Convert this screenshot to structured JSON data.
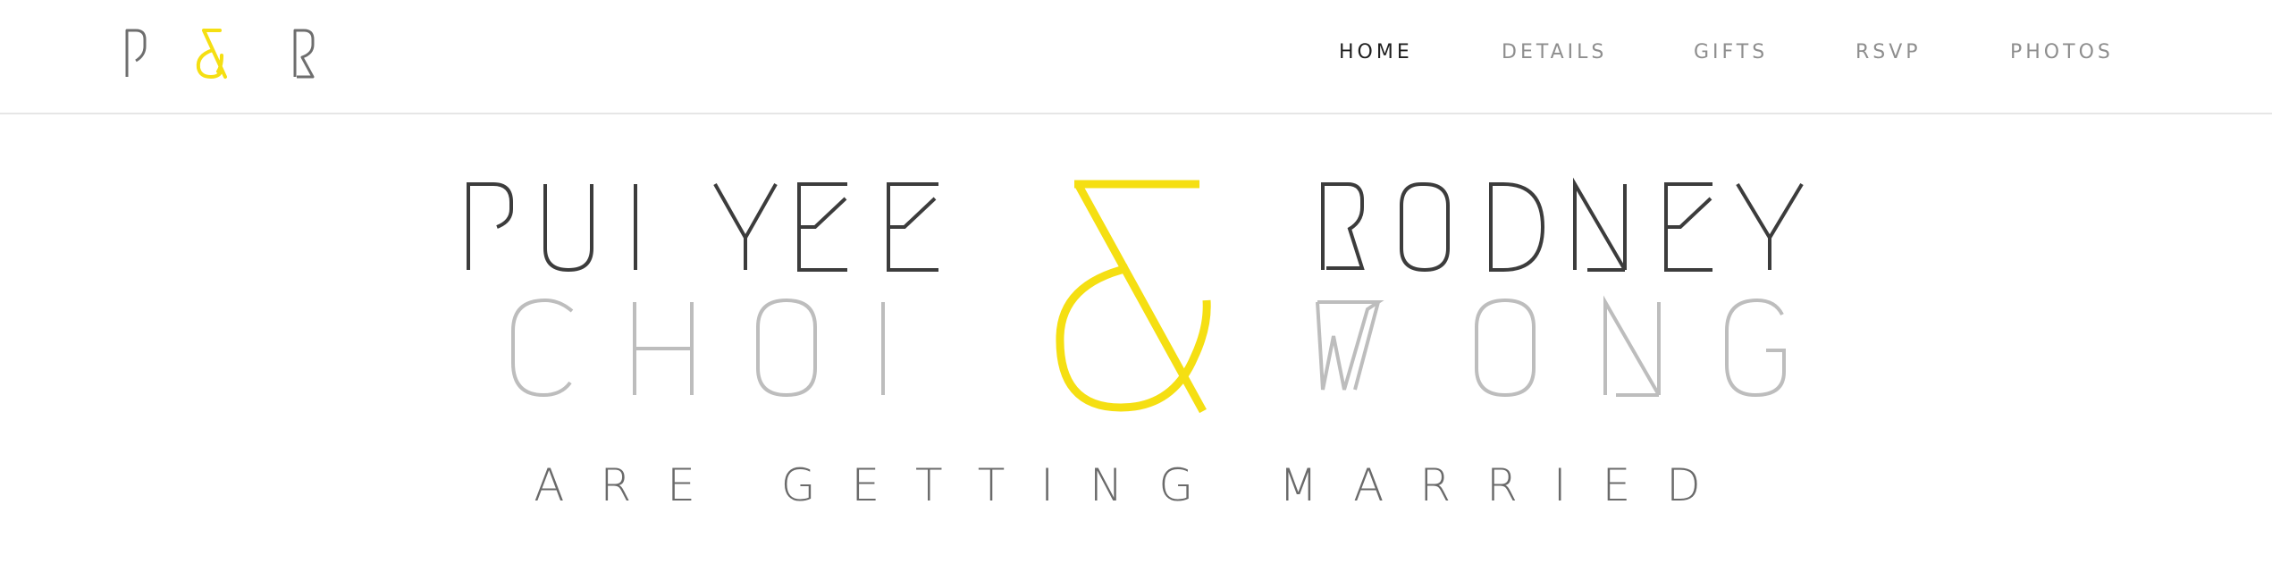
{
  "colors": {
    "accent": "#f5df12",
    "dark": "#3c3c3c",
    "muted": "#bdbdbd",
    "nav_inactive": "#8e8e8e",
    "nav_active": "#1f1f1f",
    "tagline": "#6a6a6a",
    "divider": "#e6e6e6"
  },
  "logo": {
    "left_letter": "P",
    "ampersand": "&",
    "right_letter": "R"
  },
  "nav": {
    "items": [
      {
        "label": "HOME",
        "active": true
      },
      {
        "label": "DETAILS",
        "active": false
      },
      {
        "label": "GIFTS",
        "active": false
      },
      {
        "label": "RSVP",
        "active": false
      },
      {
        "label": "PHOTOS",
        "active": false
      }
    ]
  },
  "hero": {
    "bride_first": "PUI YEE",
    "bride_last": "CHOI",
    "ampersand": "&",
    "groom_first": "RODNEY",
    "groom_last": "WONG",
    "tagline": "ARE GETTING MARRIED"
  }
}
